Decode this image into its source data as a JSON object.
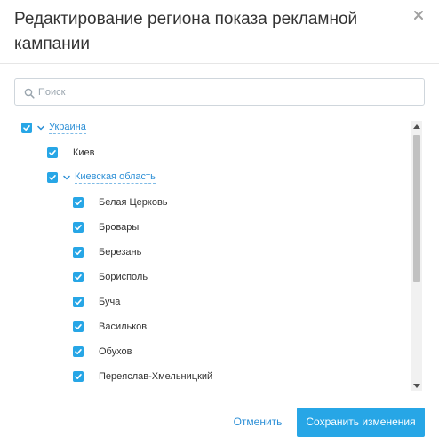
{
  "dialog": {
    "title": "Редактирование региона показа рекламной кампании",
    "close_icon": "close-icon"
  },
  "search": {
    "placeholder": "Поиск",
    "value": "",
    "icon": "search-icon"
  },
  "tree": {
    "items": [
      {
        "label": "Украина",
        "checked": true,
        "expandable": true,
        "expanded": true,
        "level": 0
      },
      {
        "label": "Киев",
        "checked": true,
        "expandable": false,
        "level": 1
      },
      {
        "label": "Киевская область",
        "checked": true,
        "expandable": true,
        "expanded": true,
        "level": 1
      },
      {
        "label": "Белая Церковь",
        "checked": true,
        "expandable": false,
        "level": 2
      },
      {
        "label": "Бровары",
        "checked": true,
        "expandable": false,
        "level": 2
      },
      {
        "label": "Березань",
        "checked": true,
        "expandable": false,
        "level": 2
      },
      {
        "label": "Борисполь",
        "checked": true,
        "expandable": false,
        "level": 2
      },
      {
        "label": "Буча",
        "checked": true,
        "expandable": false,
        "level": 2
      },
      {
        "label": "Васильков",
        "checked": true,
        "expandable": false,
        "level": 2
      },
      {
        "label": "Обухов",
        "checked": true,
        "expandable": false,
        "level": 2
      },
      {
        "label": "Переяслав-Хмельницкий",
        "checked": true,
        "expandable": false,
        "level": 2
      }
    ]
  },
  "footer": {
    "cancel_label": "Отменить",
    "save_label": "Сохранить изменения"
  },
  "colors": {
    "accent": "#27a6e6",
    "link": "#2c8fd6"
  }
}
